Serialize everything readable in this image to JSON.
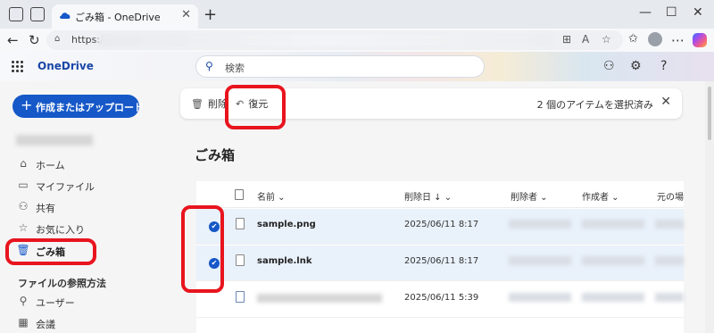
{
  "browser": {
    "tab_title": "ごみ箱 - OneDrive",
    "tab_close": "✕",
    "new_tab": "+",
    "url_prefix": "https:/",
    "window_buttons": [
      "—",
      "☐",
      "✕"
    ]
  },
  "header": {
    "brand": "OneDrive",
    "search_placeholder": "検索"
  },
  "sidebar": {
    "create_label": "作成またはアップロード",
    "items": [
      {
        "label": "ホーム",
        "icon": "home-icon"
      },
      {
        "label": "マイファイル",
        "icon": "folder-icon"
      },
      {
        "label": "共有",
        "icon": "people-icon"
      },
      {
        "label": "お気に入り",
        "icon": "star-icon"
      },
      {
        "label": "ごみ箱",
        "icon": "trash-icon",
        "active": true
      }
    ],
    "section_title": "ファイルの参照方法",
    "section_items": [
      {
        "label": "ユーザー",
        "icon": "person-icon"
      },
      {
        "label": "会議",
        "icon": "calendar-icon"
      }
    ]
  },
  "commandbar": {
    "delete_label": "削除",
    "restore_label": "復元",
    "selection_text": "2 個のアイテムを選択済み"
  },
  "main": {
    "title": "ごみ箱",
    "columns": [
      "名前",
      "削除日",
      "削除者",
      "作成者",
      "元の場"
    ],
    "rows": [
      {
        "name": "sample.png",
        "date": "2025/06/11 8:17",
        "selected": true
      },
      {
        "name": "sample.lnk",
        "date": "2025/06/11 8:17",
        "selected": true
      },
      {
        "name": "",
        "date": "2025/06/11 5:39",
        "selected": false
      }
    ]
  },
  "colors": {
    "accent": "#1658c8",
    "annotation": "#e8141e"
  }
}
